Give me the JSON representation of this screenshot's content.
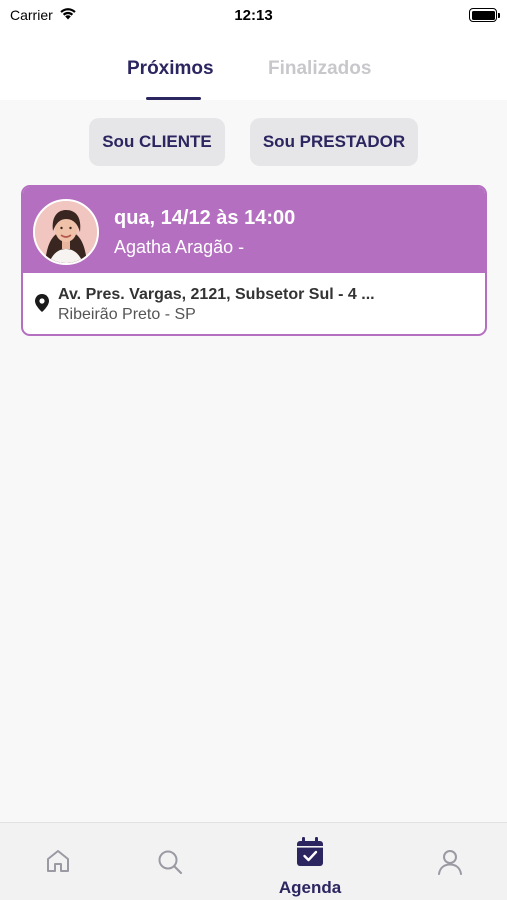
{
  "status_bar": {
    "carrier": "Carrier",
    "time": "12:13"
  },
  "tabs": [
    {
      "label": "Próximos",
      "active": true
    },
    {
      "label": "Finalizados",
      "active": false
    }
  ],
  "role_buttons": {
    "cliente": "Sou CLIENTE",
    "prestador": "Sou PRESTADOR"
  },
  "appointments": [
    {
      "date": "qua, 14/12 às 14:00",
      "name": "Agatha Aragão -",
      "address_line1": "Av. Pres. Vargas, 2121, Subsetor Sul - 4 ...",
      "address_line2": "Ribeirão Preto - SP"
    }
  ],
  "bottom_nav": {
    "items": [
      {
        "icon": "home-icon",
        "label": ""
      },
      {
        "icon": "search-icon",
        "label": ""
      },
      {
        "icon": "calendar-check-icon",
        "label": "Agenda",
        "active": true
      },
      {
        "icon": "user-icon",
        "label": ""
      }
    ]
  },
  "colors": {
    "primary": "#2b2560",
    "accent": "#b46fc0",
    "inactive": "#c8c8cc"
  }
}
